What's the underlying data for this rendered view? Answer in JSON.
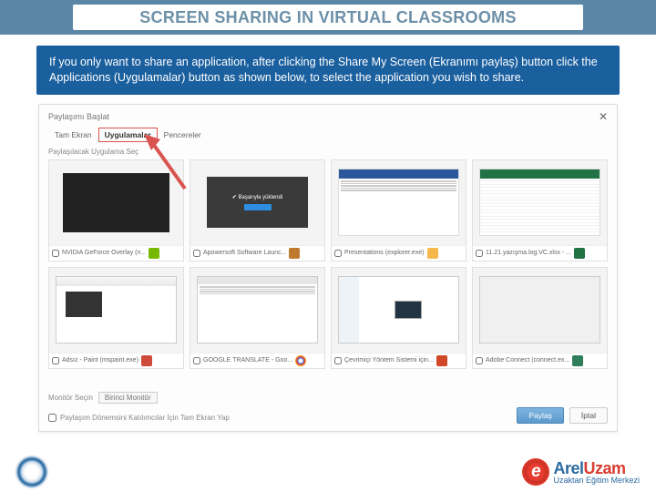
{
  "page_title": "SCREEN SHARING IN VIRTUAL CLASSROOMS",
  "instruction": "If you only want to share an application, after clicking the Share My Screen (Ekranımı paylaş) button click the Applications (Uygulamalar) button as shown below, to select the application you wish to share.",
  "dialog": {
    "title": "Paylaşımı Başlat",
    "tabs": {
      "full": "Tam Ekran",
      "apps": "Uygulamalar",
      "windows": "Pencereler"
    },
    "subhead": "Paylaşılacak Uygulama Seç",
    "tiles": [
      {
        "label": "NVIDIA GeForce Overlay (n...",
        "color": "#76b900"
      },
      {
        "label": "Apowersoft Software Launc...",
        "color": "#c07a2f"
      },
      {
        "label": "Presentations (explorer.exe)",
        "color": "#f7b84b"
      },
      {
        "label": "11.21.yazışma.log.VC.xlsx - ...",
        "color": "#217346"
      },
      {
        "label": "Adsız - Paint (mspaint.exe)",
        "color": "#d04a3c"
      },
      {
        "label": "GOOGLE TRANSLATE - Goo...",
        "color": "#4c8bf5"
      },
      {
        "label": "Çevrimiçi Yöntem Sistemi için...",
        "color": "#d24726"
      },
      {
        "label": "Adobe Connect (connect.ex...",
        "color": "#2e7d5b"
      }
    ],
    "monitor_label": "Monitör Seçin",
    "monitor_value": "Birinci Monitör",
    "fullscreen_check": "Paylaşım Dönemsini Katılımcılar İçin Tam Ekran Yap",
    "share_btn": "Paylaş",
    "cancel_btn": "İptal"
  },
  "brand": {
    "name_a": "Arel",
    "name_b": "Uzam",
    "tagline": "Uzaktan Eğitim Merkezi",
    "e": "e"
  }
}
